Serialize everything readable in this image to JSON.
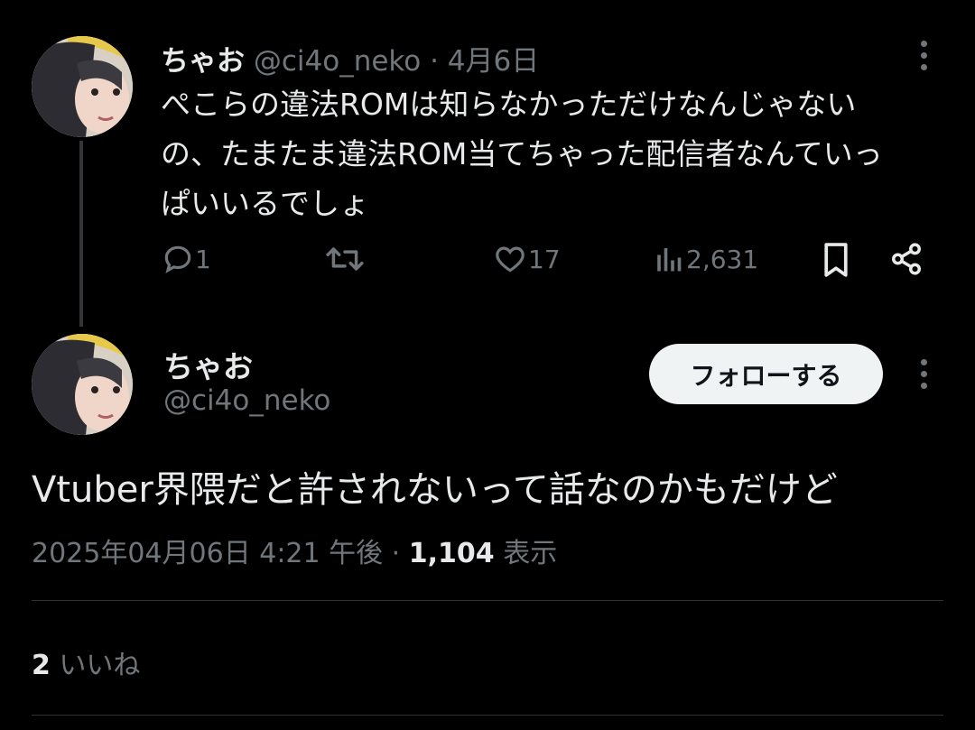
{
  "parent_tweet": {
    "display_name": "ちゃお",
    "handle_and_date": "@ci4o_neko · 4月6日",
    "text_line1": "ぺこらの違法ROMは知らなかっただけなんじゃない",
    "text_line2": "の、たまたま違法ROM当てちゃった配信者なんていっ",
    "text_line3": "ぱいいるでしょ",
    "replies": "1",
    "likes": "17",
    "views": "2,631",
    "icons": [
      "reply-icon",
      "retweet-icon",
      "like-icon",
      "views-icon",
      "bookmark-icon",
      "share-icon",
      "more-icon"
    ]
  },
  "main_tweet": {
    "display_name": "ちゃお",
    "handle": "@ci4o_neko",
    "follow_label": "フォローする",
    "text": "Vtuber界隈だと許されないって話なのかもだけど",
    "timestamp": "2025年04月06日 4:21 午後 · ",
    "view_count": "1,104",
    "view_label": " 表示",
    "like_count": "2",
    "like_label": " いいね"
  },
  "colors": {
    "background": "#000000",
    "text": "#e7e9ea",
    "secondary": "#71767b",
    "divider": "#2f3336",
    "button": "#eff3f4"
  }
}
